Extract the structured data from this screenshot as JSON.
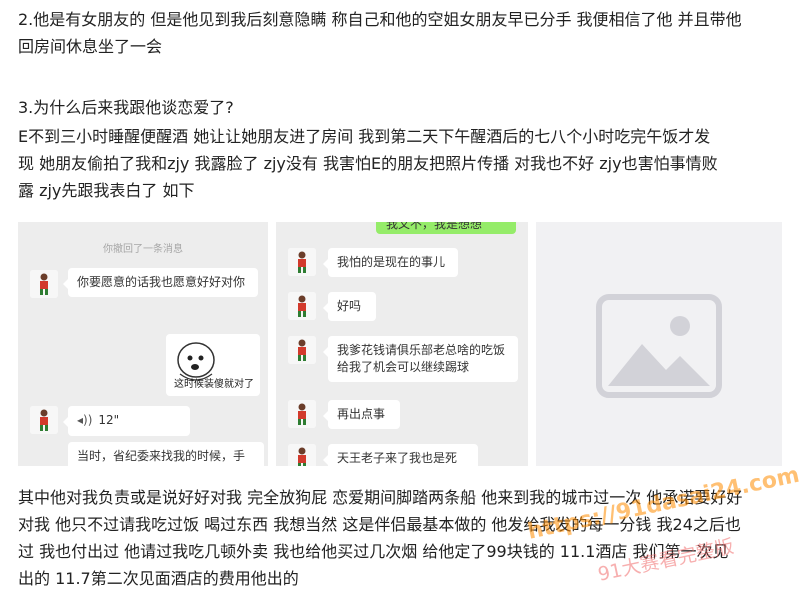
{
  "paragraphs": {
    "p1_lines": [
      "2.他是有女朋友的 但是他见到我后刻意隐瞒 称自己和他的空姐女朋友早已分手 我便相信了他 并且带他",
      "回房间休息坐了一会"
    ],
    "p2_title": "3.为什么后来我跟他谈恋爱了?",
    "p2_lines": [
      "E不到三小时睡醒便醒酒 她让让她朋友进了房间 我到第二天下午醒酒后的七八个小时吃完午饭才发",
      "现 她朋友偷拍了我和zjy 我露脸了 zjy没有 我害怕E的朋友把照片传播 对我也不好 zjy也害怕事情败",
      "露 zjy先跟我表白了 如下"
    ],
    "p3_lines": [
      "其中他对我负责或是说好好对我 完全放狗屁 恋爱期间脚踏两条船 他来到我的城市过一次 他承诺要好好",
      "对我 他只不过请我吃过饭 喝过东西 我想当然 这是伴侣最基本做的 他发给我发的每一分钱 我24之后也",
      "过 我也付出过 他请过我吃几顿外卖 我也给他买过几次烟 给他定了99块钱的 11.1酒店 我们第一次见",
      "出的 11.7第二次见面酒店的费用他出的"
    ]
  },
  "chat1": {
    "system_note": "你撤回了一条消息",
    "msg1": "你要愿意的话我也愿意好好对你",
    "sticker_caption": "这时候装傻就对了",
    "voice_duration": "12\"",
    "msg3": "当时，省纪委来找我的时候，手机里只有文字，我是要给"
  },
  "chat2": {
    "top_green": "我又不，我是想想",
    "msgs": [
      "我怕的是现在的事儿",
      "好吗",
      "我爹花钱请俱乐部老总啥的吃饭给我了机会可以继续踢球",
      "再出点事",
      "天王老子来了我也是死"
    ]
  },
  "chat3": {
    "image_icon": "image-placeholder-icon"
  },
  "watermark": {
    "line1": "https://91dasai24.com",
    "line2": "91大赛看完整版"
  }
}
